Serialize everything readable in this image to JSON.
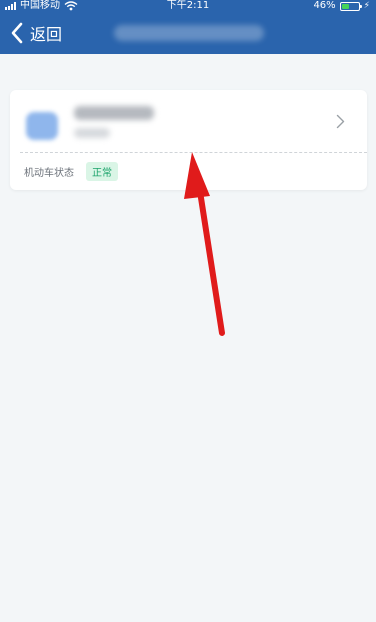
{
  "status_bar": {
    "carrier": "中国移动",
    "time": "下午2:11",
    "battery_percent_text": "46%",
    "battery_level": 0.46,
    "charging_icon": "lightning-icon"
  },
  "nav": {
    "back_label": "返回",
    "back_icon": "chevron-left-icon"
  },
  "card": {
    "status_label": "机动车状态",
    "status_value": "正常",
    "arrow_icon": "chevron-right-icon"
  },
  "colors": {
    "header_blue": "#2a64ad",
    "page_bg": "#f3f6f8",
    "status_green": "#1aa36a",
    "status_green_bg": "#daf5e6",
    "annotation_red": "#e01b1b"
  }
}
